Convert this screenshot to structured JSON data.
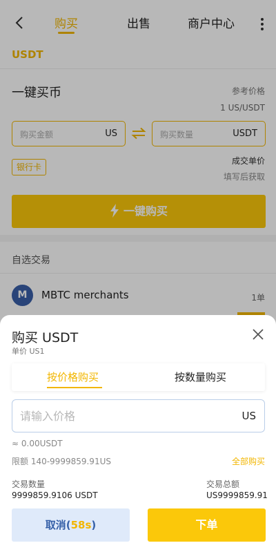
{
  "header": {
    "tabs": [
      {
        "label": "购买",
        "active": true
      },
      {
        "label": "出售",
        "active": false
      },
      {
        "label": "商户中心",
        "active": false
      }
    ]
  },
  "coin": {
    "name": "USDT"
  },
  "quick_buy": {
    "title": "一键买币",
    "ref_price_label": "参考价格",
    "ref_price_value": "1 US/USDT",
    "amount_placeholder": "购买金额",
    "amount_unit": "US",
    "quantity_placeholder": "购买数量",
    "quantity_unit": "USDT",
    "payment_badge": "银行卡",
    "deal_price_label": "成交单价",
    "deal_price_value": "填写后获取",
    "button_label": "一键购买"
  },
  "self_select": {
    "title": "自选交易",
    "merchants": [
      {
        "avatar_letter": "M",
        "name": "MBTC merchants",
        "orders": "1单"
      }
    ]
  },
  "sheet": {
    "title": "购买 USDT",
    "unit_price": "单价 US1",
    "tabs": [
      "按价格购买",
      "按数量购买"
    ],
    "price_placeholder": "请输入价格",
    "price_unit": "US",
    "approx": "≈ 0.00USDT",
    "limit": "限额 140-9999859.91US",
    "buy_all": "全部购买",
    "qty_label": "交易数量",
    "qty_value": "9999859.9106 USDT",
    "total_label": "交易总额",
    "total_value": "US9999859.91",
    "cancel_label": "取消(",
    "cancel_countdown": "58s",
    "cancel_close": ")",
    "order_label": "下单"
  },
  "colors": {
    "accent": "#f2b600",
    "button_yellow": "#fbc80a",
    "cancel_bg": "#dfeafa",
    "cancel_text": "#3560a8",
    "avatar": "#3a5fa8"
  },
  "icons": [
    "back-arrow-icon",
    "more-vertical-icon",
    "swap-arrows-icon",
    "lightning-icon",
    "close-icon"
  ]
}
